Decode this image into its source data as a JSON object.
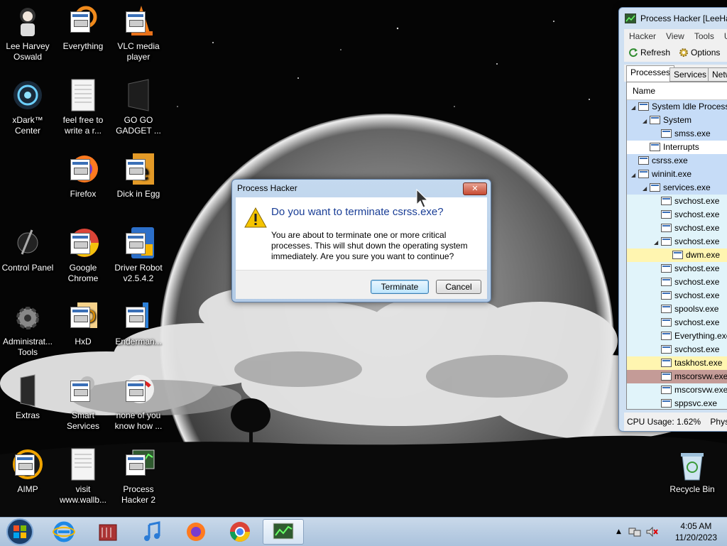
{
  "desktop": {
    "icons": [
      {
        "label": "Lee Harvey Oswald",
        "icon": "person-avatar-icon"
      },
      {
        "label": "Everything",
        "icon": "everything-search-icon"
      },
      {
        "label": "VLC media player",
        "icon": "vlc-cone-icon"
      },
      {
        "label": "xDark™ Center",
        "icon": "xdark-orb-icon"
      },
      {
        "label": "feel free to write a r...",
        "icon": "text-document-icon"
      },
      {
        "label": "GO GO GADGET ...",
        "icon": "black-box-icon"
      },
      {
        "label": "Firefox",
        "icon": "firefox-icon"
      },
      {
        "label": "Dick in Egg",
        "icon": "app-shortcut-icon"
      },
      {
        "label": "Control Panel",
        "icon": "control-panel-icon"
      },
      {
        "label": "Google Chrome",
        "icon": "chrome-icon"
      },
      {
        "label": "Driver Robot v2.5.4.2",
        "icon": "driver-robot-icon"
      },
      {
        "label": "Administrat... Tools",
        "icon": "admin-tools-gear-icon"
      },
      {
        "label": "HxD",
        "icon": "hxd-icon"
      },
      {
        "label": "Enderman...",
        "icon": "app-shortcut-icon"
      },
      {
        "label": "Extras",
        "icon": "extras-folder-icon"
      },
      {
        "label": "Smart Services",
        "icon": "smart-services-icon"
      },
      {
        "label": "none of you know how ...",
        "icon": "app-shortcut-icon"
      },
      {
        "label": "AIMP",
        "icon": "aimp-icon"
      },
      {
        "label": "visit www.wallb...",
        "icon": "text-document-icon"
      },
      {
        "label": "Process Hacker 2",
        "icon": "process-hacker-icon"
      },
      {
        "label": "Recycle Bin",
        "icon": "recycle-bin-icon"
      }
    ]
  },
  "process_hacker": {
    "title": "Process Hacker [LeeHar",
    "menu": [
      "Hacker",
      "View",
      "Tools",
      "U"
    ],
    "toolbar": {
      "refresh": "Refresh",
      "options": "Options"
    },
    "tabs": [
      "Processes",
      "Services",
      "Netw"
    ],
    "column_name": "Name",
    "processes": [
      {
        "name": "System Idle Process",
        "depth": 0,
        "expanded": true,
        "color": "#c6dcf7"
      },
      {
        "name": "System",
        "depth": 1,
        "expanded": true,
        "color": "#c6dcf7"
      },
      {
        "name": "smss.exe",
        "depth": 2,
        "expanded": null,
        "color": "#c6dcf7"
      },
      {
        "name": "Interrupts",
        "depth": 1,
        "expanded": null,
        "color": "#ffffff"
      },
      {
        "name": "csrss.exe",
        "depth": 0,
        "expanded": null,
        "color": "#c6dcf7"
      },
      {
        "name": "wininit.exe",
        "depth": 0,
        "expanded": true,
        "color": "#c6dcf7"
      },
      {
        "name": "services.exe",
        "depth": 1,
        "expanded": true,
        "color": "#c6dcf7"
      },
      {
        "name": "svchost.exe",
        "depth": 2,
        "expanded": null,
        "color": "#e1f4fa"
      },
      {
        "name": "svchost.exe",
        "depth": 2,
        "expanded": null,
        "color": "#e1f4fa"
      },
      {
        "name": "svchost.exe",
        "depth": 2,
        "expanded": null,
        "color": "#e1f4fa"
      },
      {
        "name": "svchost.exe",
        "depth": 2,
        "expanded": true,
        "color": "#e1f4fa"
      },
      {
        "name": "dwm.exe",
        "depth": 3,
        "expanded": null,
        "color": "#fff5b0"
      },
      {
        "name": "svchost.exe",
        "depth": 2,
        "expanded": null,
        "color": "#e1f4fa"
      },
      {
        "name": "svchost.exe",
        "depth": 2,
        "expanded": null,
        "color": "#e1f4fa"
      },
      {
        "name": "svchost.exe",
        "depth": 2,
        "expanded": null,
        "color": "#e1f4fa"
      },
      {
        "name": "spoolsv.exe",
        "depth": 2,
        "expanded": null,
        "color": "#e1f4fa"
      },
      {
        "name": "svchost.exe",
        "depth": 2,
        "expanded": null,
        "color": "#e1f4fa"
      },
      {
        "name": "Everything.exe",
        "depth": 2,
        "expanded": null,
        "color": "#e1f4fa"
      },
      {
        "name": "svchost.exe",
        "depth": 2,
        "expanded": null,
        "color": "#e1f4fa"
      },
      {
        "name": "taskhost.exe",
        "depth": 2,
        "expanded": null,
        "color": "#fff5b0"
      },
      {
        "name": "mscorsvw.exe",
        "depth": 2,
        "expanded": null,
        "color": "#c49b97"
      },
      {
        "name": "mscorsvw.exe",
        "depth": 2,
        "expanded": null,
        "color": "#e1f4fa"
      },
      {
        "name": "sppsvc.exe",
        "depth": 2,
        "expanded": null,
        "color": "#e1f4fa"
      }
    ],
    "status": {
      "cpu": "CPU Usage: 1.62%",
      "phys": "Physi"
    }
  },
  "dialog": {
    "title": "Process Hacker",
    "close_label": "✕",
    "heading": "Do you want to terminate csrss.exe?",
    "message": "You are about to terminate one or more critical processes. This will shut down the operating system immediately. Are you sure you want to continue?",
    "terminate_label": "Terminate",
    "cancel_label": "Cancel"
  },
  "taskbar": {
    "pinned": [
      "start-orb-icon",
      "internet-explorer-icon",
      "media-center-icon",
      "itunes-music-icon",
      "firefox-icon",
      "chrome-icon",
      "process-hacker-icon"
    ],
    "clock_time": "4:05 AM",
    "clock_date": "11/20/2023"
  }
}
